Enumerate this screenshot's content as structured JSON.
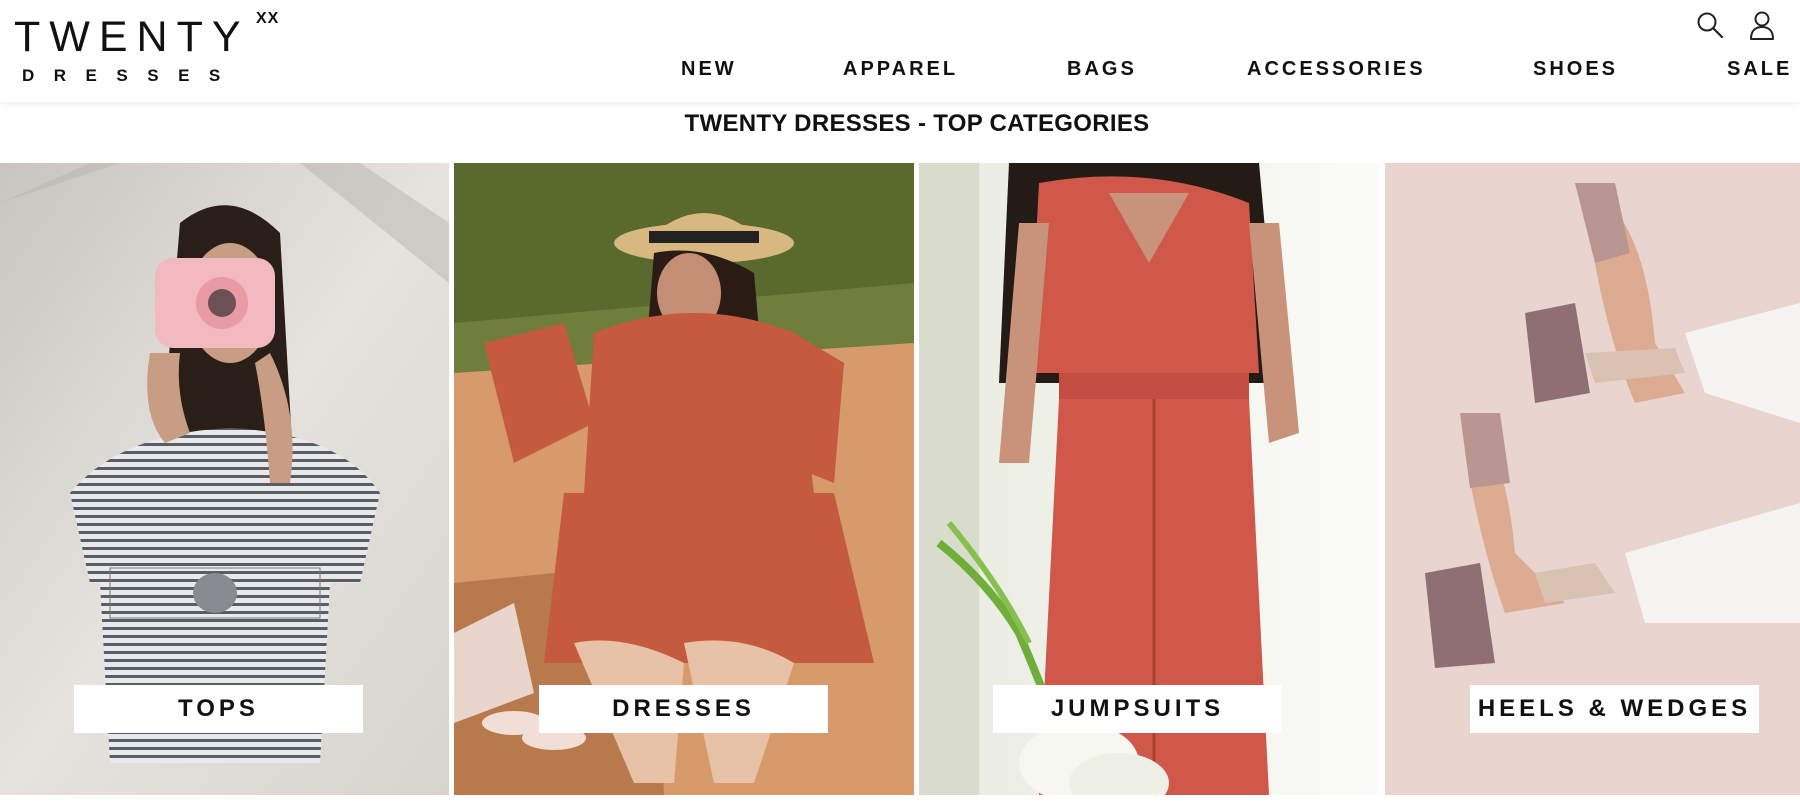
{
  "brand": {
    "name": "TWENTY",
    "superscript": "XX",
    "subline": "DRESSES"
  },
  "header_icons": [
    {
      "icon": "search-icon"
    },
    {
      "icon": "user-icon"
    }
  ],
  "nav": {
    "items": [
      {
        "label": "NEW"
      },
      {
        "label": "APPAREL"
      },
      {
        "label": "BAGS"
      },
      {
        "label": "ACCESSORIES"
      },
      {
        "label": "SHOES"
      },
      {
        "label": "SALE"
      }
    ]
  },
  "section": {
    "title": "TWENTY DRESSES - TOP CATEGORIES"
  },
  "categories": [
    {
      "label": "TOPS"
    },
    {
      "label": "DRESSES"
    },
    {
      "label": "JUMPSUITS"
    },
    {
      "label": "HEELS & WEDGES"
    }
  ],
  "colors": {
    "text": "#111111",
    "background": "#ffffff",
    "accent_orange": "#c9513a"
  }
}
